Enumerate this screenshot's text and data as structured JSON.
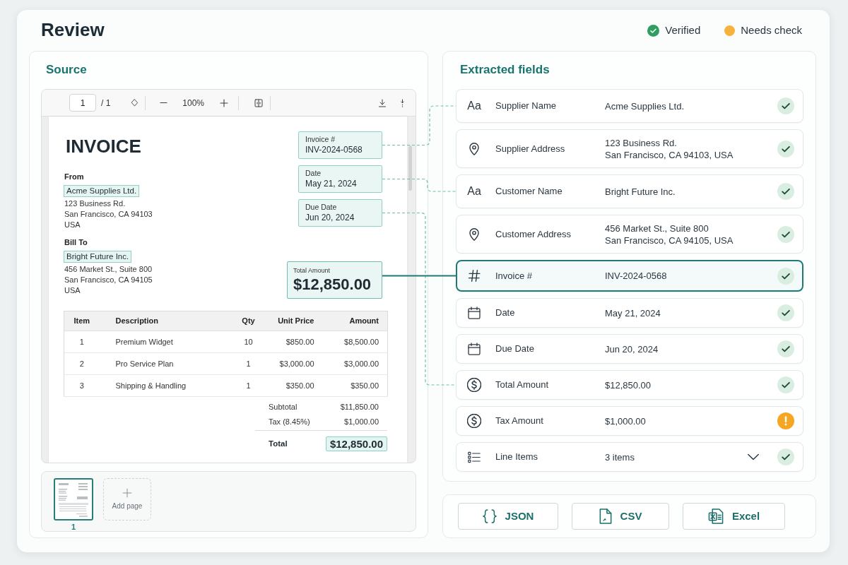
{
  "header": {
    "title": "Review",
    "legend": [
      {
        "kind": "verified",
        "label": "Verified"
      },
      {
        "kind": "needs_check",
        "label": "Needs check"
      }
    ]
  },
  "source": {
    "title": "Source",
    "toolbar": {
      "page": "1",
      "page_count": "/ 1",
      "zoom": "100%"
    },
    "document": {
      "title": "INVOICE",
      "parties": [
        {
          "label": "From",
          "name": "Acme Supplies Ltd.",
          "highlighted": true,
          "lines": [
            "123 Business Rd.",
            "San Francisco, CA 94103",
            "USA"
          ]
        },
        {
          "label": "Bill To",
          "name": "Bright Future Inc.",
          "highlighted": true,
          "lines": [
            "456 Market St., Suite 800",
            "San Francisco, CA 94105",
            "USA"
          ]
        }
      ],
      "tags": [
        {
          "kind": "field",
          "label": "Invoice #",
          "value": "INV-2024-0568"
        },
        {
          "kind": "field",
          "label": "Date",
          "value": "May 21, 2024"
        },
        {
          "kind": "field",
          "label": "Due Date",
          "value": "Jun 20, 2024"
        },
        {
          "kind": "amount",
          "label": "Total Amount",
          "value": "$12,850.00"
        }
      ],
      "table": {
        "columns": [
          "Item",
          "Description",
          "Qty",
          "Unit Price",
          "Amount"
        ],
        "rows": [
          [
            "1",
            "Premium Widget",
            "10",
            "$850.00",
            "$8,500.00"
          ],
          [
            "2",
            "Pro Service Plan",
            "1",
            "$3,000.00",
            "$3,000.00"
          ],
          [
            "3",
            "Shipping & Handling",
            "1",
            "$350.00",
            "$350.00"
          ]
        ]
      },
      "totals": [
        {
          "kind": "plain",
          "label": "Subtotal",
          "value": "$11,850.00"
        },
        {
          "kind": "plain",
          "label": "Tax (8.45%)",
          "value": "$1,000.00"
        },
        {
          "kind": "grand",
          "label": "Total",
          "value": "$12,850.00"
        }
      ]
    },
    "pages": [
      {
        "label": "1",
        "selected": true
      }
    ],
    "add_page": "Add page"
  },
  "fields": {
    "title": "Extracted fields",
    "items": [
      {
        "kind": "text",
        "glyph": "Aa",
        "label": "Supplier Name",
        "value": [
          "Acme Supplies Ltd."
        ],
        "verified": true,
        "selected": false
      },
      {
        "kind": "address",
        "label": "Supplier Address",
        "value": [
          "123 Business Rd.",
          "San Francisco, CA 94103, USA"
        ],
        "verified": true,
        "selected": false
      },
      {
        "kind": "text",
        "glyph": "Aa",
        "label": "Customer Name",
        "value": [
          "Bright Future Inc."
        ],
        "verified": true,
        "selected": false
      },
      {
        "kind": "address",
        "label": "Customer Address",
        "value": [
          "456 Market St., Suite 800",
          "San Francisco, CA 94105, USA"
        ],
        "verified": true,
        "selected": false
      },
      {
        "kind": "number",
        "label": "Invoice #",
        "value": [
          "INV-2024-0568"
        ],
        "verified": true,
        "selected": true
      },
      {
        "kind": "date",
        "label": "Date",
        "value": [
          "May 21, 2024"
        ],
        "verified": true,
        "selected": false
      },
      {
        "kind": "date",
        "label": "Due Date",
        "value": [
          "Jun 20, 2024"
        ],
        "verified": true,
        "selected": false
      },
      {
        "kind": "amount",
        "label": "Total Amount",
        "value": [
          "$12,850.00"
        ],
        "verified": true,
        "selected": false
      },
      {
        "kind": "amount",
        "label": "Tax Amount",
        "value": [
          "$1,000.00"
        ],
        "verified": false,
        "selected": false
      },
      {
        "kind": "list",
        "label": "Line Items",
        "value": [
          "3 items"
        ],
        "verified": true,
        "selected": false,
        "expanded": false
      }
    ]
  },
  "exports": [
    {
      "kind": "json",
      "label": "JSON"
    },
    {
      "kind": "csv",
      "label": "CSV"
    },
    {
      "kind": "excel",
      "label": "Excel"
    }
  ]
}
